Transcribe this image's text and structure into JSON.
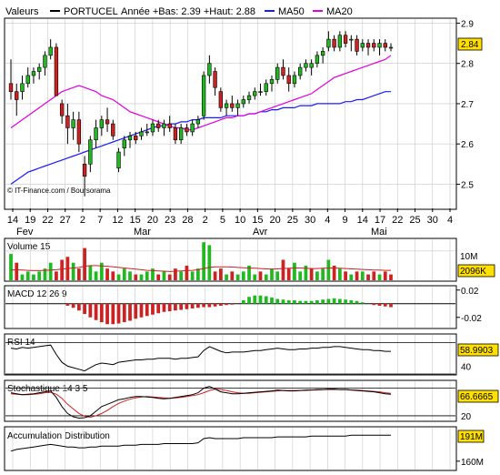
{
  "header": {
    "prefix": "Valeurs",
    "stock": "PORTUCEL",
    "stats": "Année +Bas: 2.39 +Haut: 2.88",
    "ma50_label": "MA50",
    "ma20_label": "MA20",
    "credit": "© IT-Finance.com / Boursorama"
  },
  "colors": {
    "up": "#21b821",
    "down": "#cc2222",
    "ma50": "#1a1aff",
    "ma20": "#e000e0",
    "stoch_signal": "#d02020",
    "grid": "#c8c8c8",
    "badge": "#ffe000"
  },
  "chart_data": [
    {
      "type": "candlestick",
      "title": "PORTUCEL",
      "ylim": [
        2.44,
        2.91
      ],
      "yticks": [
        2.5,
        2.6,
        2.7,
        2.8,
        2.9
      ],
      "last_value": "2.84",
      "x_ticks": [
        "14",
        "19",
        "22",
        "27",
        "2",
        "7",
        "12",
        "15",
        "20",
        "23",
        "28",
        "2",
        "5",
        "10",
        "15",
        "20",
        "25",
        "30",
        "4",
        "9",
        "14",
        "17",
        "22",
        "25",
        "30",
        "4"
      ],
      "months": [
        "Fev",
        "Mar",
        "Avr",
        "Mai"
      ],
      "grid": true,
      "candles": [
        {
          "o": 2.75,
          "h": 2.81,
          "l": 2.71,
          "c": 2.73
        },
        {
          "o": 2.73,
          "h": 2.75,
          "l": 2.67,
          "c": 2.71
        },
        {
          "o": 2.73,
          "h": 2.77,
          "l": 2.71,
          "c": 2.75
        },
        {
          "o": 2.75,
          "h": 2.79,
          "l": 2.74,
          "c": 2.77
        },
        {
          "o": 2.77,
          "h": 2.79,
          "l": 2.75,
          "c": 2.78
        },
        {
          "o": 2.78,
          "h": 2.8,
          "l": 2.76,
          "c": 2.79
        },
        {
          "o": 2.79,
          "h": 2.83,
          "l": 2.77,
          "c": 2.82
        },
        {
          "o": 2.82,
          "h": 2.86,
          "l": 2.81,
          "c": 2.84
        },
        {
          "o": 2.84,
          "h": 2.85,
          "l": 2.74,
          "c": 2.72
        },
        {
          "o": 2.7,
          "h": 2.71,
          "l": 2.65,
          "c": 2.67
        },
        {
          "o": 2.67,
          "h": 2.7,
          "l": 2.6,
          "c": 2.64
        },
        {
          "o": 2.64,
          "h": 2.68,
          "l": 2.61,
          "c": 2.66
        },
        {
          "o": 2.66,
          "h": 2.68,
          "l": 2.58,
          "c": 2.6
        },
        {
          "o": 2.55,
          "h": 2.57,
          "l": 2.47,
          "c": 2.52
        },
        {
          "o": 2.55,
          "h": 2.62,
          "l": 2.53,
          "c": 2.61
        },
        {
          "o": 2.61,
          "h": 2.66,
          "l": 2.59,
          "c": 2.64
        },
        {
          "o": 2.64,
          "h": 2.67,
          "l": 2.62,
          "c": 2.66
        },
        {
          "o": 2.66,
          "h": 2.69,
          "l": 2.63,
          "c": 2.65
        },
        {
          "o": 2.65,
          "h": 2.66,
          "l": 2.61,
          "c": 2.62
        },
        {
          "o": 2.54,
          "h": 2.59,
          "l": 2.53,
          "c": 2.58
        },
        {
          "o": 2.59,
          "h": 2.62,
          "l": 2.57,
          "c": 2.61
        },
        {
          "o": 2.61,
          "h": 2.63,
          "l": 2.59,
          "c": 2.62
        },
        {
          "o": 2.62,
          "h": 2.63,
          "l": 2.6,
          "c": 2.61
        },
        {
          "o": 2.62,
          "h": 2.64,
          "l": 2.61,
          "c": 2.63
        },
        {
          "o": 2.63,
          "h": 2.65,
          "l": 2.62,
          "c": 2.63
        },
        {
          "o": 2.63,
          "h": 2.66,
          "l": 2.62,
          "c": 2.65
        },
        {
          "o": 2.65,
          "h": 2.66,
          "l": 2.63,
          "c": 2.64
        },
        {
          "o": 2.64,
          "h": 2.66,
          "l": 2.62,
          "c": 2.65
        },
        {
          "o": 2.65,
          "h": 2.67,
          "l": 2.63,
          "c": 2.64
        },
        {
          "o": 2.64,
          "h": 2.65,
          "l": 2.6,
          "c": 2.61
        },
        {
          "o": 2.61,
          "h": 2.65,
          "l": 2.6,
          "c": 2.64
        },
        {
          "o": 2.64,
          "h": 2.65,
          "l": 2.62,
          "c": 2.63
        },
        {
          "o": 2.63,
          "h": 2.66,
          "l": 2.62,
          "c": 2.65
        },
        {
          "o": 2.65,
          "h": 2.67,
          "l": 2.64,
          "c": 2.66
        },
        {
          "o": 2.67,
          "h": 2.78,
          "l": 2.66,
          "c": 2.77
        },
        {
          "o": 2.77,
          "h": 2.82,
          "l": 2.75,
          "c": 2.8
        },
        {
          "o": 2.78,
          "h": 2.79,
          "l": 2.72,
          "c": 2.74
        },
        {
          "o": 2.73,
          "h": 2.74,
          "l": 2.68,
          "c": 2.69
        },
        {
          "o": 2.69,
          "h": 2.71,
          "l": 2.67,
          "c": 2.7
        },
        {
          "o": 2.7,
          "h": 2.72,
          "l": 2.68,
          "c": 2.69
        },
        {
          "o": 2.69,
          "h": 2.71,
          "l": 2.67,
          "c": 2.7
        },
        {
          "o": 2.7,
          "h": 2.72,
          "l": 2.69,
          "c": 2.71
        },
        {
          "o": 2.71,
          "h": 2.73,
          "l": 2.7,
          "c": 2.72
        },
        {
          "o": 2.72,
          "h": 2.74,
          "l": 2.71,
          "c": 2.73
        },
        {
          "o": 2.73,
          "h": 2.75,
          "l": 2.72,
          "c": 2.73
        },
        {
          "o": 2.73,
          "h": 2.76,
          "l": 2.72,
          "c": 2.75
        },
        {
          "o": 2.75,
          "h": 2.77,
          "l": 2.73,
          "c": 2.76
        },
        {
          "o": 2.76,
          "h": 2.8,
          "l": 2.75,
          "c": 2.79
        },
        {
          "o": 2.79,
          "h": 2.81,
          "l": 2.76,
          "c": 2.77
        },
        {
          "o": 2.77,
          "h": 2.79,
          "l": 2.73,
          "c": 2.75
        },
        {
          "o": 2.75,
          "h": 2.78,
          "l": 2.74,
          "c": 2.77
        },
        {
          "o": 2.77,
          "h": 2.8,
          "l": 2.76,
          "c": 2.79
        },
        {
          "o": 2.79,
          "h": 2.81,
          "l": 2.78,
          "c": 2.8
        },
        {
          "o": 2.79,
          "h": 2.81,
          "l": 2.77,
          "c": 2.8
        },
        {
          "o": 2.8,
          "h": 2.83,
          "l": 2.79,
          "c": 2.82
        },
        {
          "o": 2.82,
          "h": 2.84,
          "l": 2.8,
          "c": 2.83
        },
        {
          "o": 2.84,
          "h": 2.88,
          "l": 2.83,
          "c": 2.86
        },
        {
          "o": 2.86,
          "h": 2.87,
          "l": 2.83,
          "c": 2.84
        },
        {
          "o": 2.84,
          "h": 2.88,
          "l": 2.83,
          "c": 2.87
        },
        {
          "o": 2.87,
          "h": 2.88,
          "l": 2.84,
          "c": 2.85
        },
        {
          "o": 2.86,
          "h": 2.87,
          "l": 2.83,
          "c": 2.86
        },
        {
          "o": 2.86,
          "h": 2.87,
          "l": 2.82,
          "c": 2.83
        },
        {
          "o": 2.84,
          "h": 2.86,
          "l": 2.83,
          "c": 2.85
        },
        {
          "o": 2.85,
          "h": 2.86,
          "l": 2.82,
          "c": 2.84
        },
        {
          "o": 2.85,
          "h": 2.86,
          "l": 2.83,
          "c": 2.84
        },
        {
          "o": 2.84,
          "h": 2.86,
          "l": 2.82,
          "c": 2.85
        },
        {
          "o": 2.85,
          "h": 2.86,
          "l": 2.83,
          "c": 2.84
        },
        {
          "o": 2.84,
          "h": 2.85,
          "l": 2.83,
          "c": 2.84
        }
      ],
      "ma20": [
        2.64,
        2.65,
        2.66,
        2.67,
        2.68,
        2.69,
        2.7,
        2.71,
        2.72,
        2.73,
        2.735,
        2.74,
        2.745,
        2.74,
        2.735,
        2.73,
        2.72,
        2.715,
        2.71,
        2.7,
        2.69,
        2.68,
        2.675,
        2.67,
        2.665,
        2.66,
        2.655,
        2.65,
        2.645,
        2.64,
        2.64,
        2.635,
        2.635,
        2.64,
        2.645,
        2.65,
        2.655,
        2.66,
        2.665,
        2.665,
        2.67,
        2.67,
        2.675,
        2.675,
        2.68,
        2.685,
        2.69,
        2.695,
        2.7,
        2.705,
        2.71,
        2.715,
        2.72,
        2.725,
        2.735,
        2.745,
        2.755,
        2.765,
        2.77,
        2.775,
        2.78,
        2.785,
        2.79,
        2.795,
        2.8,
        2.805,
        2.81,
        2.82
      ],
      "ma50": [
        2.5,
        2.51,
        2.52,
        2.53,
        2.535,
        2.54,
        2.545,
        2.55,
        2.555,
        2.56,
        2.565,
        2.57,
        2.575,
        2.58,
        2.585,
        2.59,
        2.595,
        2.6,
        2.605,
        2.61,
        2.615,
        2.62,
        2.625,
        2.63,
        2.635,
        2.64,
        2.645,
        2.645,
        2.65,
        2.65,
        2.655,
        2.655,
        2.66,
        2.66,
        2.665,
        2.665,
        2.665,
        2.665,
        2.67,
        2.67,
        2.67,
        2.67,
        2.675,
        2.675,
        2.68,
        2.68,
        2.685,
        2.685,
        2.69,
        2.69,
        2.69,
        2.695,
        2.695,
        2.695,
        2.7,
        2.7,
        2.7,
        2.7,
        2.7,
        2.705,
        2.705,
        2.71,
        2.71,
        2.715,
        2.72,
        2.725,
        2.73,
        2.73
      ]
    },
    {
      "type": "bar",
      "title": "Volume 15",
      "yticks_labels": [
        "10M"
      ],
      "ylim": [
        0,
        14
      ],
      "last_value": "2096K",
      "values": [
        9,
        6,
        2,
        3,
        2,
        3,
        4,
        6,
        3,
        7,
        8,
        6,
        4,
        11,
        5,
        3,
        6,
        4,
        3,
        2,
        4,
        3,
        2,
        2,
        3,
        4,
        2,
        3,
        2,
        4,
        3,
        5,
        3,
        4,
        13,
        12,
        3,
        4,
        2,
        3,
        2,
        3,
        5,
        2,
        3,
        2,
        4,
        3,
        7,
        4,
        6,
        3,
        5,
        4,
        3,
        4,
        7,
        5,
        4,
        3,
        2,
        3,
        3,
        2,
        3,
        2,
        3,
        2
      ],
      "ma15": [
        3.5,
        3.6,
        3.5,
        3.4,
        3.3,
        3.3,
        3.4,
        3.5,
        3.6,
        3.8,
        4.0,
        4.2,
        4.4,
        4.8,
        5.0,
        5.0,
        4.9,
        4.8,
        4.6,
        4.4,
        4.2,
        4.0,
        3.8,
        3.6,
        3.4,
        3.3,
        3.2,
        3.1,
        3.0,
        3.1,
        3.2,
        3.3,
        3.4,
        3.6,
        4.0,
        4.4,
        4.6,
        4.6,
        4.6,
        4.5,
        4.4,
        4.3,
        4.2,
        4.1,
        4.0,
        3.9,
        3.8,
        3.9,
        4.0,
        4.1,
        4.2,
        4.2,
        4.1,
        4.0,
        4.0,
        4.1,
        4.2,
        4.2,
        4.1,
        4.0,
        3.9,
        3.8,
        3.7,
        3.6,
        3.5,
        3.5,
        3.4,
        3.4
      ],
      "colors_up": [
        true,
        false,
        true,
        true,
        true,
        true,
        true,
        true,
        false,
        false,
        false,
        true,
        false,
        false,
        true,
        true,
        true,
        false,
        false,
        true,
        true,
        true,
        false,
        true,
        true,
        true,
        false,
        true,
        false,
        false,
        true,
        false,
        true,
        true,
        true,
        true,
        false,
        false,
        true,
        false,
        true,
        true,
        true,
        true,
        false,
        true,
        true,
        true,
        false,
        false,
        true,
        true,
        true,
        false,
        true,
        true,
        true,
        false,
        true,
        false,
        true,
        false,
        true,
        false,
        false,
        true,
        false,
        false
      ]
    },
    {
      "type": "bar",
      "title": "MACD 12 26 9",
      "yticks_labels": [
        "0.02",
        "-0.02"
      ],
      "ytick_values": [
        0.02,
        -0.02
      ],
      "ylim": [
        -0.035,
        0.025
      ],
      "values": [
        0.0,
        0.0,
        0.0,
        0.0,
        0.0,
        0.0,
        0.0,
        0.0,
        0.0,
        0.0,
        -0.003,
        -0.006,
        -0.01,
        -0.015,
        -0.02,
        -0.024,
        -0.027,
        -0.03,
        -0.03,
        -0.029,
        -0.027,
        -0.025,
        -0.022,
        -0.02,
        -0.018,
        -0.016,
        -0.014,
        -0.012,
        -0.011,
        -0.01,
        -0.009,
        -0.008,
        -0.007,
        -0.006,
        -0.005,
        -0.005,
        -0.004,
        -0.003,
        -0.002,
        -0.001,
        0.0,
        0.005,
        0.01,
        0.012,
        0.012,
        0.011,
        0.009,
        0.007,
        0.006,
        0.005,
        0.005,
        0.004,
        0.004,
        0.004,
        0.005,
        0.006,
        0.007,
        0.008,
        0.007,
        0.006,
        0.005,
        0.004,
        0.002,
        0.0,
        -0.002,
        -0.003,
        -0.004,
        -0.005
      ]
    },
    {
      "type": "line",
      "title": "RSI 14",
      "yticks_labels": [
        "40"
      ],
      "ytick_values": [
        40
      ],
      "ylim": [
        30,
        80
      ],
      "ref_lines": [
        70,
        30
      ],
      "last_value": "58.9903",
      "values": [
        63,
        62,
        64,
        63,
        64,
        65,
        66,
        67,
        55,
        45,
        40,
        38,
        36,
        34,
        38,
        42,
        44,
        43,
        42,
        45,
        46,
        47,
        48,
        48,
        49,
        49,
        50,
        50,
        50,
        49,
        50,
        50,
        51,
        52,
        60,
        65,
        62,
        59,
        57,
        58,
        58,
        58,
        59,
        60,
        60,
        61,
        62,
        63,
        62,
        61,
        61,
        62,
        62,
        63,
        63,
        64,
        64,
        65,
        65,
        64,
        63,
        62,
        61,
        61,
        60,
        60,
        59,
        59
      ]
    },
    {
      "type": "line",
      "title": "Stochastique 14 3 5",
      "yticks_labels": [
        "20"
      ],
      "ytick_values": [
        20
      ],
      "ylim": [
        10,
        95
      ],
      "ref_lines": [
        80,
        20
      ],
      "last_value": "66.6665",
      "k": [
        70,
        68,
        66,
        67,
        68,
        70,
        72,
        74,
        60,
        40,
        25,
        18,
        15,
        16,
        20,
        30,
        40,
        45,
        50,
        55,
        57,
        60,
        62,
        62,
        61,
        60,
        58,
        57,
        58,
        60,
        62,
        64,
        66,
        70,
        80,
        84,
        78,
        72,
        70,
        68,
        68,
        69,
        70,
        71,
        72,
        73,
        74,
        76,
        75,
        74,
        74,
        75,
        76,
        76,
        77,
        77,
        78,
        78,
        77,
        77,
        76,
        75,
        74,
        73,
        72,
        70,
        68,
        67
      ],
      "d": [
        68,
        67,
        66,
        66,
        67,
        68,
        70,
        71,
        67,
        58,
        45,
        35,
        25,
        19,
        17,
        20,
        25,
        32,
        40,
        47,
        52,
        56,
        59,
        61,
        62,
        61,
        60,
        59,
        58,
        59,
        60,
        62,
        64,
        66,
        70,
        75,
        78,
        77,
        75,
        72,
        70,
        69,
        69,
        70,
        71,
        72,
        73,
        74,
        75,
        75,
        75,
        75,
        75,
        76,
        76,
        77,
        77,
        77,
        77,
        77,
        76,
        76,
        75,
        74,
        73,
        72,
        70,
        69
      ]
    },
    {
      "type": "line",
      "title": "Accumulation Distribution",
      "yticks_labels": [
        "160M"
      ],
      "ytick_values": [
        160
      ],
      "ylim": [
        150,
        200
      ],
      "last_value": "191M",
      "values": [
        172,
        174,
        175,
        176,
        177,
        178,
        179,
        180,
        179,
        178,
        177,
        177,
        176,
        176,
        177,
        177,
        178,
        178,
        178,
        178,
        179,
        179,
        179,
        180,
        180,
        180,
        180,
        181,
        181,
        181,
        181,
        181,
        181,
        182,
        187,
        188,
        187,
        187,
        187,
        187,
        187,
        188,
        188,
        188,
        188,
        188,
        188,
        189,
        189,
        189,
        189,
        189,
        189,
        190,
        190,
        190,
        190,
        190,
        190,
        190,
        191,
        191,
        191,
        191,
        191,
        191,
        191,
        191
      ]
    }
  ]
}
